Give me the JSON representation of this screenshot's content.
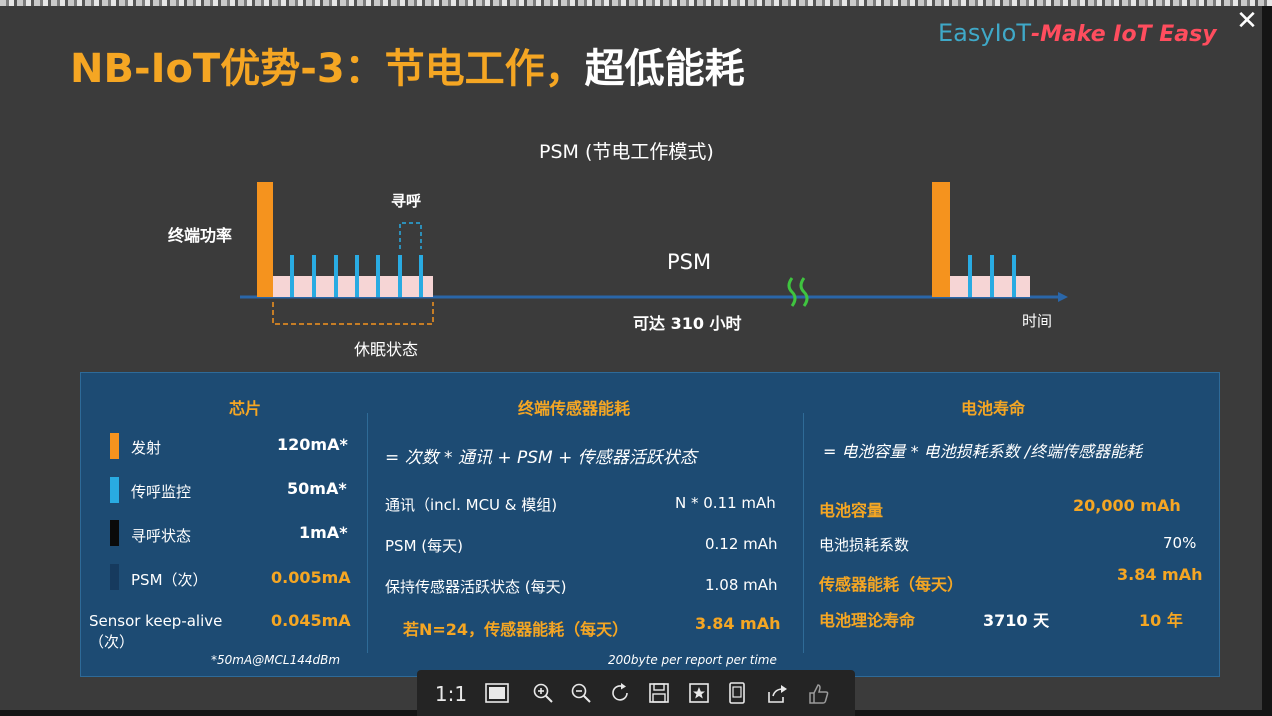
{
  "slide": {
    "title_yellow": "NB-IoT优势-3：节电工作，",
    "title_white": "超低能耗",
    "brand_prefix": "EasyIoT",
    "brand_suffix": "-Make IoT Easy"
  },
  "diagram": {
    "heading": "PSM (节电工作模式)",
    "power_label": "终端功率",
    "paging_label": "寻呼",
    "psm_label": "PSM",
    "duration_label": "可达 310 小时",
    "time_label": "时间",
    "sleep_label": "休眠状态"
  },
  "panel": {
    "chip": {
      "header": "芯片",
      "rows": [
        {
          "name": "发射",
          "value": "120mA*",
          "color": "#f5931e"
        },
        {
          "name": "传呼监控",
          "value": "50mA*",
          "color": "#29abe2"
        },
        {
          "name": "寻呼状态",
          "value": "1mA*",
          "color": "#0a0a0a"
        },
        {
          "name": "PSM（次）",
          "value": "0.005mA",
          "color": "#163a5e"
        }
      ],
      "keepalive_name_1": "Sensor keep-alive",
      "keepalive_name_2": "（次）",
      "keepalive_value": "0.045mA",
      "footnote": "*50mA@MCL144dBm"
    },
    "sensor": {
      "header": "终端传感器能耗",
      "formula": "= 次数 * 通讯 + PSM + 传感器活跃状态",
      "rows": [
        {
          "name": "通讯（incl. MCU & 模组)",
          "value": "N * 0.11 mAh"
        },
        {
          "name": "PSM (每天)",
          "value": "0.12 mAh"
        },
        {
          "name": "保持传感器活跃状态 (每天)",
          "value": "1.08 mAh"
        }
      ],
      "result_label": "若N=24，传感器能耗（每天）",
      "result_value": "3.84 mAh",
      "footnote": "200byte per report per time"
    },
    "battery": {
      "header": "电池寿命",
      "formula": "= 电池容量 * 电池损耗系数 /终端传感器能耗",
      "capacity_label": "电池容量",
      "capacity_value": "20,000 mAh",
      "loss_label": "电池损耗系数",
      "loss_value": "70%",
      "sensor_label": "传感器能耗（每天）",
      "sensor_value": "3.84 mAh",
      "life_label": "电池理论寿命",
      "life_days": "3710 天",
      "life_years": "10 年"
    }
  },
  "viewer": {
    "close_glyph": "✕",
    "actual_size_label": "1:1",
    "icons": [
      "fit-icon",
      "zoom-in-icon",
      "zoom-out-icon",
      "rotate-icon",
      "save-icon",
      "favorite-icon",
      "fullscreen-icon",
      "share-icon",
      "like-icon"
    ]
  },
  "colors": {
    "title": "#f5a623",
    "panel": "#1d4b73",
    "transmit": "#f5931e",
    "paging_monitor": "#29abe2",
    "sleep_band": "#f6d5d5"
  }
}
